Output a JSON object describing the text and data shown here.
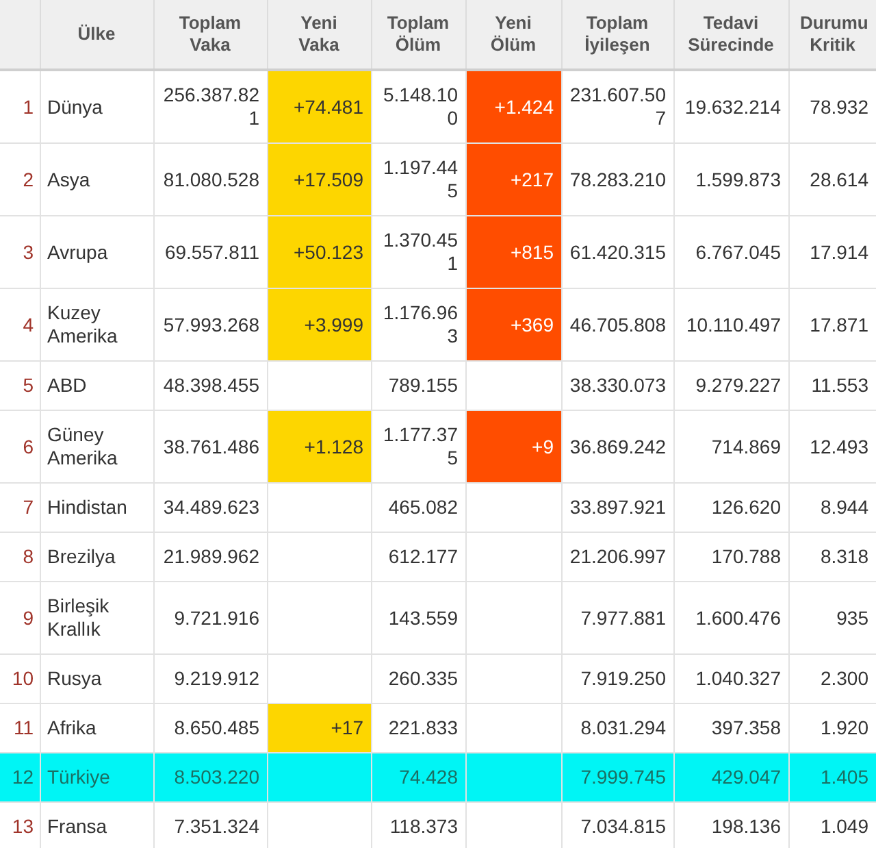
{
  "table": {
    "columns": [
      {},
      {
        "label": "Ülke"
      },
      {
        "label": "Toplam Vaka"
      },
      {
        "label": "Yeni Vaka"
      },
      {
        "label": "Toplam Ölüm"
      },
      {
        "label": "Yeni Ölüm"
      },
      {
        "label": "Toplam İyileşen"
      },
      {
        "label": "Tedavi Sürecinde"
      },
      {
        "label": "Durumu Kritik"
      }
    ],
    "rows": [
      {
        "rank": "1",
        "country": "Dünya",
        "total_cases": "256.387.821",
        "new_cases": "+74.481",
        "total_deaths": "5.148.100",
        "new_deaths": "+1.424",
        "total_recovered": "231.607.507",
        "active": "19.632.214",
        "critical": "78.932",
        "selected": false
      },
      {
        "rank": "2",
        "country": "Asya",
        "total_cases": "81.080.528",
        "new_cases": "+17.509",
        "total_deaths": "1.197.445",
        "new_deaths": "+217",
        "total_recovered": "78.283.210",
        "active": "1.599.873",
        "critical": "28.614",
        "selected": false
      },
      {
        "rank": "3",
        "country": "Avrupa",
        "total_cases": "69.557.811",
        "new_cases": "+50.123",
        "total_deaths": "1.370.451",
        "new_deaths": "+815",
        "total_recovered": "61.420.315",
        "active": "6.767.045",
        "critical": "17.914",
        "selected": false
      },
      {
        "rank": "4",
        "country": "Kuzey Amerika",
        "total_cases": "57.993.268",
        "new_cases": "+3.999",
        "total_deaths": "1.176.963",
        "new_deaths": "+369",
        "total_recovered": "46.705.808",
        "active": "10.110.497",
        "critical": "17.871",
        "selected": false
      },
      {
        "rank": "5",
        "country": "ABD",
        "total_cases": "48.398.455",
        "total_deaths": "789.155",
        "total_recovered": "38.330.073",
        "active": "9.279.227",
        "critical": "11.553",
        "selected": false
      },
      {
        "rank": "6",
        "country": "Güney Amerika",
        "total_cases": "38.761.486",
        "new_cases": "+1.128",
        "total_deaths": "1.177.375",
        "new_deaths": "+9",
        "total_recovered": "36.869.242",
        "active": "714.869",
        "critical": "12.493",
        "selected": false
      },
      {
        "rank": "7",
        "country": "Hindistan",
        "total_cases": "34.489.623",
        "total_deaths": "465.082",
        "total_recovered": "33.897.921",
        "active": "126.620",
        "critical": "8.944",
        "selected": false
      },
      {
        "rank": "8",
        "country": "Brezilya",
        "total_cases": "21.989.962",
        "total_deaths": "612.177",
        "total_recovered": "21.206.997",
        "active": "170.788",
        "critical": "8.318",
        "selected": false
      },
      {
        "rank": "9",
        "country": "Birleşik Krallık",
        "total_cases": "9.721.916",
        "total_deaths": "143.559",
        "total_recovered": "7.977.881",
        "active": "1.600.476",
        "critical": "935",
        "selected": false
      },
      {
        "rank": "10",
        "country": "Rusya",
        "total_cases": "9.219.912",
        "total_deaths": "260.335",
        "total_recovered": "7.919.250",
        "active": "1.040.327",
        "critical": "2.300",
        "selected": false
      },
      {
        "rank": "11",
        "country": "Afrika",
        "total_cases": "8.650.485",
        "new_cases": "+17",
        "total_deaths": "221.833",
        "total_recovered": "8.031.294",
        "active": "397.358",
        "critical": "1.920",
        "selected": false
      },
      {
        "rank": "12",
        "country": "Türkiye",
        "total_cases": "8.503.220",
        "total_deaths": "74.428",
        "total_recovered": "7.999.745",
        "active": "429.047",
        "critical": "1.405",
        "selected": true
      },
      {
        "rank": "13",
        "country": "Fransa",
        "total_cases": "7.351.324",
        "total_deaths": "118.373",
        "total_recovered": "7.034.815",
        "active": "198.136",
        "critical": "1.049",
        "selected": false
      }
    ]
  }
}
